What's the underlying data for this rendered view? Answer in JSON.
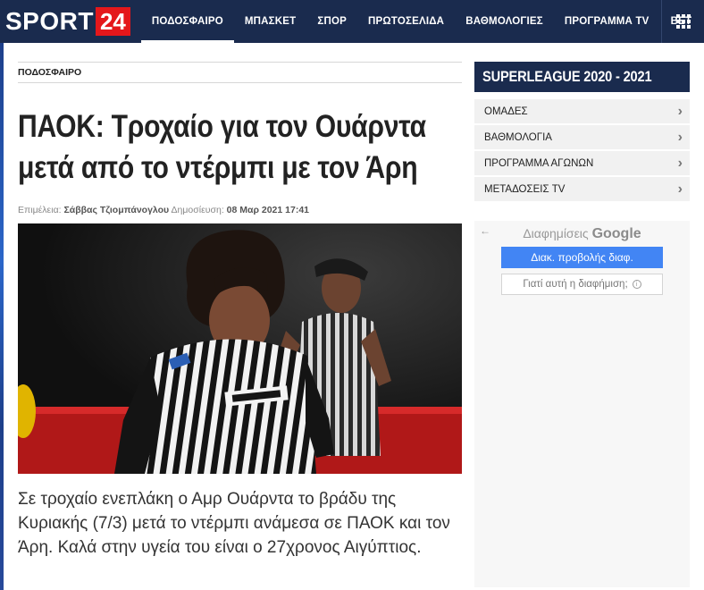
{
  "brand": {
    "name": "SPORT",
    "number": "24"
  },
  "nav": {
    "items": [
      {
        "label": "ΠΟΔΟΣΦΑΙΡΟ",
        "active": true
      },
      {
        "label": "ΜΠΑΣΚΕΤ",
        "active": false
      },
      {
        "label": "ΣΠΟΡ",
        "active": false
      },
      {
        "label": "ΠΡΩΤΟΣΕΛΙΔΑ",
        "active": false
      },
      {
        "label": "ΒΑΘΜΟΛΟΓΙΕΣ",
        "active": false
      },
      {
        "label": "ΠΡΟΓΡΑΜΜΑ TV",
        "active": false
      },
      {
        "label": "BET",
        "active": false
      }
    ],
    "menu_icon": "grid-icon"
  },
  "article": {
    "category": "ΠΟΔΟΣΦΑΙΡΟ",
    "headline": "ΠΑΟΚ: Τροχαίο για τον Ουάρντα μετά από το ντέρμπι με τον Άρη",
    "byline": {
      "editor_label": "Επιμέλεια:",
      "editor": "Σάββας Τζιομπάνογλου",
      "published_label": "Δημοσίευση:",
      "published": "08 Μαρ 2021 17:41"
    },
    "lede": "Σε τροχαίο ενεπλάκη ο Αμρ Ουάρντα το βράδυ της Κυριακής (7/3) μετά το ντέρμπι ανάμεσα σε ΠΑΟΚ και τον Άρη. Καλά στην υγεία του είναι ο 27χρονος Αιγύπτιος."
  },
  "sidebar": {
    "title": "SUPERLEAGUE 2020 - 2021",
    "items": [
      {
        "label": "ΟΜΑΔΕΣ"
      },
      {
        "label": "ΒΑΘΜΟΛΟΓΙΑ"
      },
      {
        "label": "ΠΡΟΓΡΑΜΜΑ ΑΓΩΝΩΝ"
      },
      {
        "label": "ΜΕΤΑΔΟΣΕΙΣ TV"
      }
    ]
  },
  "ad": {
    "label": "Διαφημίσεις",
    "provider": "Google",
    "stop_button": "Διακ. προβολής διαφ.",
    "why_button": "Γιατί αυτή η διαφήμιση;"
  },
  "colors": {
    "navy": "#1a2b4e",
    "brand_red": "#e4171b",
    "ad_blue": "#4285f4"
  }
}
